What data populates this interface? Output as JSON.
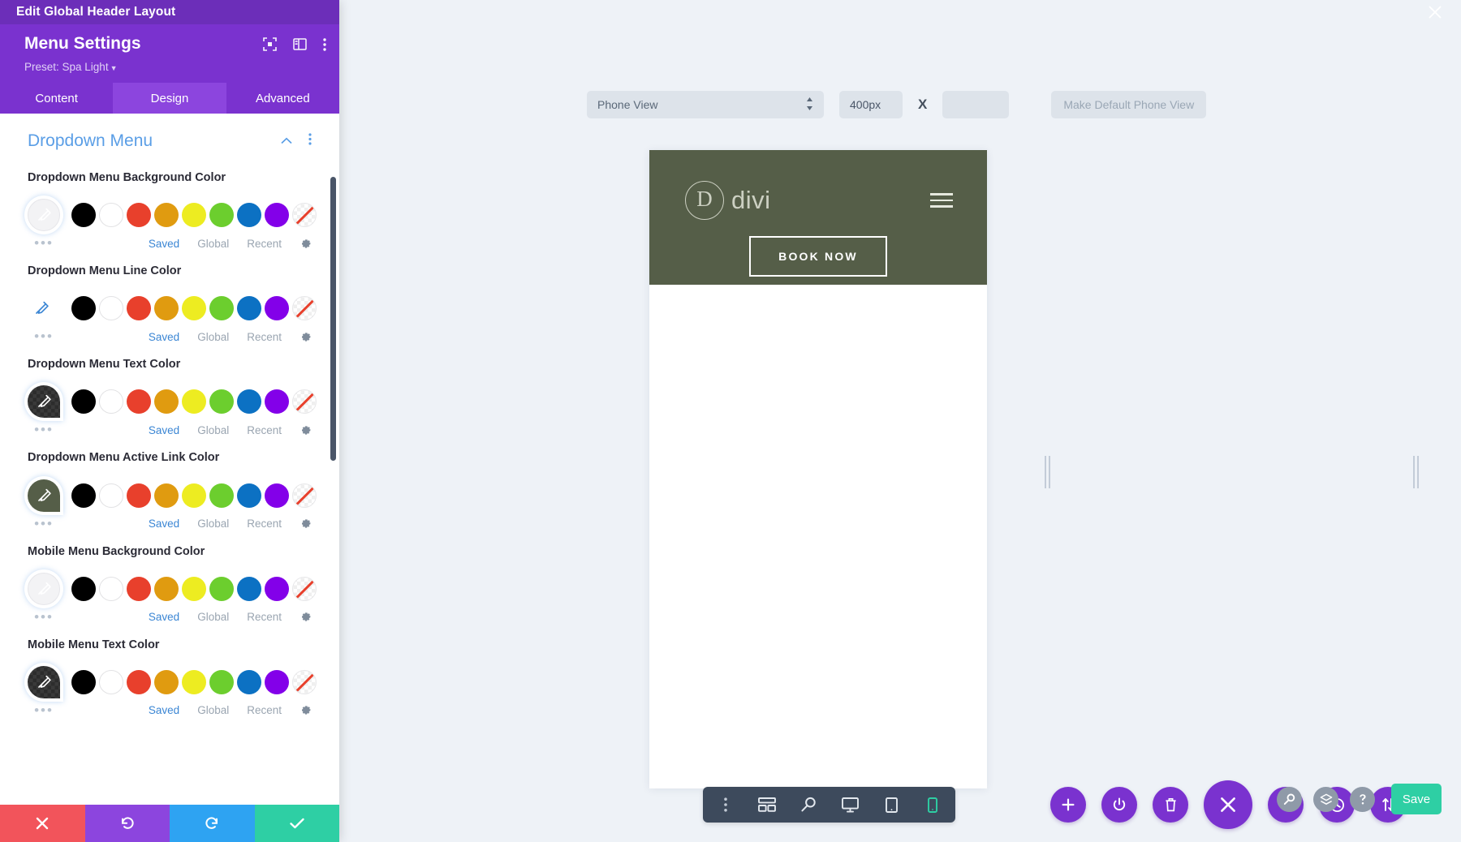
{
  "window": {
    "title": "Edit Global Header Layout",
    "close_icon": "close-icon"
  },
  "sidebar": {
    "header": {
      "title": "Menu Settings",
      "preset_label": "Preset: Spa Light",
      "icons": [
        "focus-target-icon",
        "panel-layout-icon",
        "vertical-dots-icon"
      ]
    },
    "tabs": [
      {
        "label": "Content",
        "active": false
      },
      {
        "label": "Design",
        "active": true
      },
      {
        "label": "Advanced",
        "active": false
      }
    ],
    "section": {
      "title": "Dropdown Menu",
      "collapse_icon": "chevron-up-icon",
      "more_icon": "vertical-dots-icon"
    },
    "palette": [
      {
        "name": "black",
        "hex": "#000000"
      },
      {
        "name": "white",
        "hex": "#ffffff"
      },
      {
        "name": "red",
        "hex": "#e8402c"
      },
      {
        "name": "orange",
        "hex": "#e09b10"
      },
      {
        "name": "yellow",
        "hex": "#edec21"
      },
      {
        "name": "green",
        "hex": "#6cce2e"
      },
      {
        "name": "blue",
        "hex": "#0c71c3"
      },
      {
        "name": "purple",
        "hex": "#8300e9"
      },
      {
        "name": "none",
        "hex": "transparent"
      }
    ],
    "meta_links": [
      {
        "label": "Saved",
        "active": true
      },
      {
        "label": "Global",
        "active": false
      },
      {
        "label": "Recent",
        "active": false
      }
    ],
    "meta_gear_icon": "gear-icon",
    "more_dots": "•••",
    "fields": [
      {
        "label": "Dropdown Menu Background Color",
        "swatch_hex": "#f5f5f5",
        "swatch_style": "light-ring"
      },
      {
        "label": "Dropdown Menu Line Color",
        "swatch_hex": "transparent",
        "swatch_style": "plain-pen"
      },
      {
        "label": "Dropdown Menu Text Color",
        "swatch_hex": "#3a3a3a",
        "swatch_style": "checker-dark"
      },
      {
        "label": "Dropdown Menu Active Link Color",
        "swatch_hex": "#555e48",
        "swatch_style": "solid"
      },
      {
        "label": "Mobile Menu Background Color",
        "swatch_hex": "#f5f5f5",
        "swatch_style": "light-ring"
      },
      {
        "label": "Mobile Menu Text Color",
        "swatch_hex": "#3a3a3a",
        "swatch_style": "checker-dark"
      }
    ],
    "bottom_actions": [
      {
        "name": "discard-button",
        "icon": "close-icon",
        "color": "#f2545b"
      },
      {
        "name": "undo-button",
        "icon": "undo-icon",
        "color": "#8c45de"
      },
      {
        "name": "redo-button",
        "icon": "redo-icon",
        "color": "#2ea3f2"
      },
      {
        "name": "save-check-button",
        "icon": "check-icon",
        "color": "#2ecfa4"
      }
    ]
  },
  "viewport_toolbar": {
    "view_select_value": "Phone View",
    "width_value": "400px",
    "separator": "X",
    "height_value": "",
    "height_placeholder": "",
    "make_default_label": "Make Default Phone View"
  },
  "preview": {
    "logo_letter": "D",
    "logo_text": "divi",
    "cta_label": "BOOK NOW",
    "menu_icon": "hamburger-icon",
    "header_bg": "#555e48"
  },
  "bottom_toolbar": {
    "items": [
      {
        "name": "vertical-dots-icon"
      },
      {
        "name": "wireframe-icon"
      },
      {
        "name": "zoom-icon"
      },
      {
        "name": "desktop-icon"
      },
      {
        "name": "tablet-icon"
      },
      {
        "name": "phone-icon",
        "active": true
      }
    ],
    "active_color": "#2ecfa4"
  },
  "action_bar": {
    "buttons": [
      {
        "name": "add-button",
        "icon": "plus-icon",
        "size": "small"
      },
      {
        "name": "power-button",
        "icon": "power-icon",
        "size": "small"
      },
      {
        "name": "trash-button",
        "icon": "trash-icon",
        "size": "small"
      },
      {
        "name": "close-menu-button",
        "icon": "close-icon",
        "size": "large"
      },
      {
        "name": "settings-button",
        "icon": "gear-icon",
        "size": "small"
      },
      {
        "name": "history-button",
        "icon": "clock-icon",
        "size": "small"
      },
      {
        "name": "portability-button",
        "icon": "sort-arrows-icon",
        "size": "small"
      }
    ]
  },
  "right_bar": {
    "buttons": [
      {
        "name": "search-button",
        "icon": "search-icon"
      },
      {
        "name": "layers-button",
        "icon": "layers-icon"
      },
      {
        "name": "help-button",
        "icon": "help-icon"
      }
    ],
    "save_label": "Save",
    "save_color": "#2ecfa4"
  }
}
